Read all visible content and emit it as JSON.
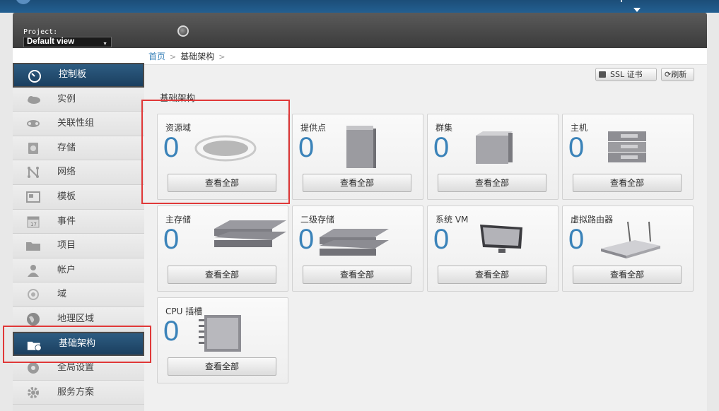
{
  "header": {
    "project_label": "Project:",
    "project_value": "Default view"
  },
  "breadcrumb": {
    "home": "首页",
    "current": "基础架构"
  },
  "toolbar": {
    "ssl_label": "SSL 证书",
    "refresh_label": "刷新"
  },
  "section_title": "基础架构",
  "sidebar": {
    "items": [
      {
        "label": "控制板",
        "icon": "dashboard-icon",
        "active": true
      },
      {
        "label": "实例",
        "icon": "cloud-icon"
      },
      {
        "label": "关联性组",
        "icon": "affinity-group-icon"
      },
      {
        "label": "存储",
        "icon": "storage-icon"
      },
      {
        "label": "网络",
        "icon": "network-icon"
      },
      {
        "label": "模板",
        "icon": "template-icon"
      },
      {
        "label": "事件",
        "icon": "calendar-icon"
      },
      {
        "label": "项目",
        "icon": "folder-icon"
      },
      {
        "label": "帐户",
        "icon": "user-icon"
      },
      {
        "label": "域",
        "icon": "domain-icon"
      },
      {
        "label": "地理区域",
        "icon": "globe-icon"
      },
      {
        "label": "基础架构",
        "icon": "infrastructure-icon",
        "active": true
      },
      {
        "label": "全局设置",
        "icon": "global-settings-icon"
      },
      {
        "label": "服务方案",
        "icon": "gear-icon"
      }
    ]
  },
  "cards": [
    {
      "title": "资源域",
      "count": "0",
      "button": "查看全部",
      "icon": "zone-icon"
    },
    {
      "title": "提供点",
      "count": "0",
      "button": "查看全部",
      "icon": "pod-icon"
    },
    {
      "title": "群集",
      "count": "0",
      "button": "查看全部",
      "icon": "cluster-icon"
    },
    {
      "title": "主机",
      "count": "0",
      "button": "查看全部",
      "icon": "host-icon"
    },
    {
      "title": "主存储",
      "count": "0",
      "button": "查看全部",
      "icon": "primary-storage-icon"
    },
    {
      "title": "二级存储",
      "count": "0",
      "button": "查看全部",
      "icon": "secondary-storage-icon"
    },
    {
      "title": "系统 VM",
      "count": "0",
      "button": "查看全部",
      "icon": "system-vm-icon"
    },
    {
      "title": "虚拟路由器",
      "count": "0",
      "button": "查看全部",
      "icon": "router-icon"
    },
    {
      "title": "CPU 插槽",
      "count": "0",
      "button": "查看全部",
      "icon": "cpu-socket-icon"
    }
  ],
  "colors": {
    "accent": "#3b83b9",
    "active_nav": "#1b3f5f",
    "highlight": "#e03838"
  }
}
